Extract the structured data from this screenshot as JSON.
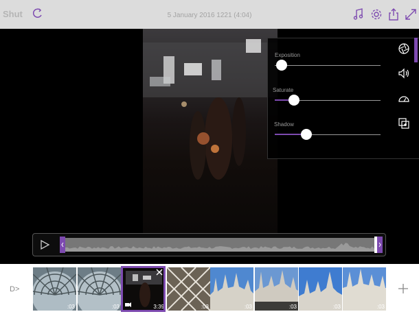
{
  "header": {
    "app_name": "Shut",
    "title": "5 January 2016 1221 (4:04)",
    "icons": [
      "refresh-icon",
      "music-note-icon",
      "gear-icon",
      "share-icon",
      "expand-icon"
    ]
  },
  "adjustments": {
    "sliders": [
      {
        "label": "Exposition",
        "value": 0.0
      },
      {
        "label": "Saturate",
        "value": 0.18
      },
      {
        "label": "Shadow",
        "value": 0.3
      }
    ],
    "side_icons": [
      "aperture-icon",
      "volume-icon",
      "speedometer-icon",
      "crop-copy-icon"
    ]
  },
  "timeline": {
    "play_icon": "play-icon"
  },
  "filmstrip": {
    "start_label": "D>",
    "clips": [
      {
        "kind": "dome",
        "duration": ":03",
        "selected": false
      },
      {
        "kind": "dome",
        "duration": ":03",
        "selected": false
      },
      {
        "kind": "video-night",
        "duration": "3:39",
        "selected": true
      },
      {
        "kind": "lattice",
        "duration": ":03",
        "selected": false
      },
      {
        "kind": "cathedral",
        "duration": ":03",
        "selected": false
      },
      {
        "kind": "cathedral",
        "duration": ":03",
        "selected": false
      },
      {
        "kind": "cathedral",
        "duration": ":03",
        "selected": false
      },
      {
        "kind": "cathedral",
        "duration": ":03",
        "selected": false
      }
    ],
    "add_icon": "plus-icon"
  },
  "colors": {
    "accent": "#7d4ab0",
    "topbar": "#dcdcdc",
    "filmstrip": "#ffffff"
  }
}
